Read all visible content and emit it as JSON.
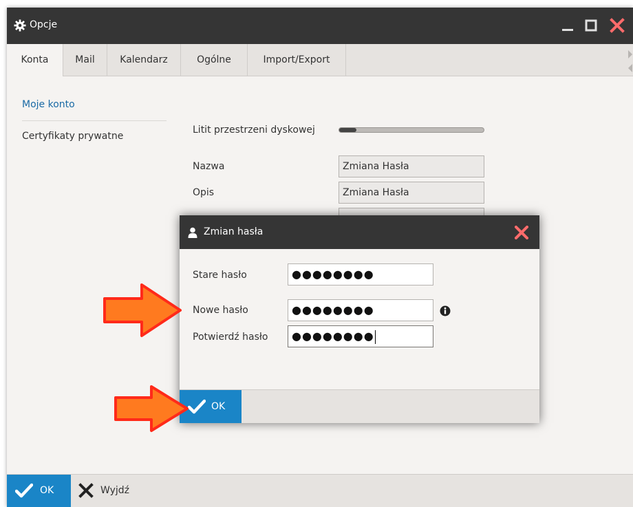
{
  "window": {
    "title": "Opcje",
    "icons": {
      "app": "gear-icon",
      "minimize": "minimize-icon",
      "maximize": "maximize-icon",
      "close": "close-icon"
    }
  },
  "tabs": [
    {
      "label": "Konta",
      "active": true
    },
    {
      "label": "Mail",
      "active": false
    },
    {
      "label": "Kalendarz",
      "active": false
    },
    {
      "label": "Ogólne",
      "active": false
    },
    {
      "label": "Import/Export",
      "active": false
    }
  ],
  "sidebar": {
    "items": [
      {
        "label": "Moje konto",
        "active": true
      },
      {
        "label": "Certyfikaty prywatne",
        "active": false
      }
    ]
  },
  "account_form": {
    "storage_label": "Litit przestrzeni dyskowej",
    "storage_progress": 0.12,
    "name_label": "Nazwa",
    "name_value": "Zmiana Hasła",
    "description_label": "Opis",
    "description_value": "Zmiana Hasła"
  },
  "dialog": {
    "title": "Zmian hasła",
    "icons": {
      "title": "user-icon",
      "close": "close-icon",
      "info": "info-icon",
      "ok": "checkmark-icon"
    },
    "old_password_label": "Stare hasło",
    "old_password_value": "●●●●●●●●",
    "new_password_label": "Nowe hasło",
    "new_password_value": "●●●●●●●●",
    "confirm_password_label": "Potwierdź hasło",
    "confirm_password_value": "●●●●●●●●",
    "ok_label": "OK"
  },
  "footer": {
    "ok_label": "OK",
    "exit_label": "Wyjdź",
    "icons": {
      "ok": "checkmark-icon",
      "exit": "x-icon"
    }
  },
  "colors": {
    "titlebar": "#353535",
    "accent": "#1a85c7",
    "close_red": "#ff6b6b",
    "link_blue": "#1a6aa5",
    "annotation_arrow": "#ff7a1f",
    "annotation_outline": "#ff2a1a"
  }
}
